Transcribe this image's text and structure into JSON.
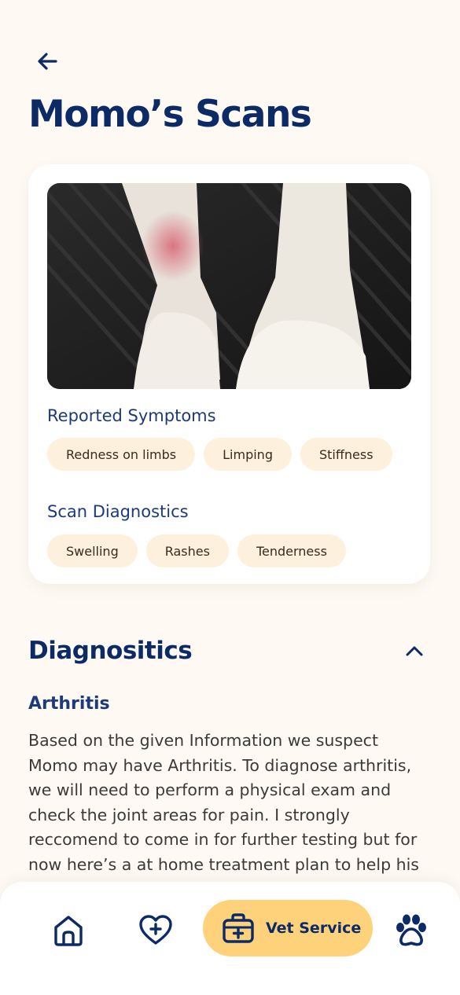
{
  "header": {
    "back_icon": "arrow-left-icon",
    "title": "Momo’s Scans"
  },
  "scan_card": {
    "image": "photo of dog front legs with red inflamed patch",
    "symptoms_label": "Reported Symptoms",
    "symptoms": [
      "Redness on limbs",
      "Limping",
      "Stiffness"
    ],
    "diagnostics_label": "Scan Diagnostics",
    "diagnostics": [
      "Swelling",
      "Rashes",
      "Tenderness"
    ]
  },
  "diagnostics_section": {
    "title": "Diagnositics",
    "collapse_icon": "chevron-up-icon",
    "condition": "Arthritis",
    "body": "Based on the given Information we suspect Momo may have Arthritis. To diagnose arthritis, we will need to  perform a physical exam and check the joint areas for pain. I strongly reccomend to come in for further testing but for now here’s a at home treatment plan to help his arthritis comfort."
  },
  "bottom_nav": {
    "items": [
      {
        "icon": "home-icon"
      },
      {
        "icon": "heart-plus-icon"
      },
      {
        "icon": "medical-kit-icon",
        "label": "Vet Service",
        "active": true
      },
      {
        "icon": "paw-icon"
      }
    ]
  },
  "colors": {
    "background": "#FEFAF3",
    "navy": "#0B2A66",
    "chip_bg": "#FDF0DC",
    "active_nav": "#FDD27A"
  }
}
